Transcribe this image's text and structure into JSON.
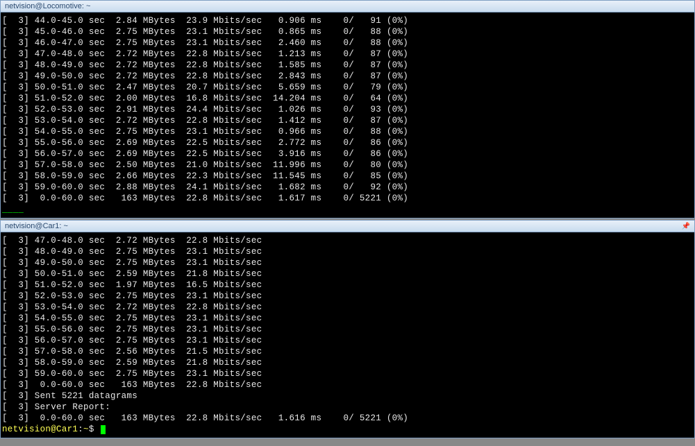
{
  "pane1": {
    "title": "netvision@Locomotive: ~",
    "pin": "",
    "rows": [
      {
        "id": "3",
        "interval": "44.0-45.0",
        "unit": "sec",
        "transfer": "2.84",
        "tunit": "MBytes",
        "bw": "23.9",
        "bwunit": "Mbits/sec",
        "jitter": "0.906",
        "junit": "ms",
        "lost": "0",
        "total": "91",
        "pct": "(0%)"
      },
      {
        "id": "3",
        "interval": "45.0-46.0",
        "unit": "sec",
        "transfer": "2.75",
        "tunit": "MBytes",
        "bw": "23.1",
        "bwunit": "Mbits/sec",
        "jitter": "0.865",
        "junit": "ms",
        "lost": "0",
        "total": "88",
        "pct": "(0%)"
      },
      {
        "id": "3",
        "interval": "46.0-47.0",
        "unit": "sec",
        "transfer": "2.75",
        "tunit": "MBytes",
        "bw": "23.1",
        "bwunit": "Mbits/sec",
        "jitter": "2.460",
        "junit": "ms",
        "lost": "0",
        "total": "88",
        "pct": "(0%)"
      },
      {
        "id": "3",
        "interval": "47.0-48.0",
        "unit": "sec",
        "transfer": "2.72",
        "tunit": "MBytes",
        "bw": "22.8",
        "bwunit": "Mbits/sec",
        "jitter": "1.213",
        "junit": "ms",
        "lost": "0",
        "total": "87",
        "pct": "(0%)"
      },
      {
        "id": "3",
        "interval": "48.0-49.0",
        "unit": "sec",
        "transfer": "2.72",
        "tunit": "MBytes",
        "bw": "22.8",
        "bwunit": "Mbits/sec",
        "jitter": "1.585",
        "junit": "ms",
        "lost": "0",
        "total": "87",
        "pct": "(0%)"
      },
      {
        "id": "3",
        "interval": "49.0-50.0",
        "unit": "sec",
        "transfer": "2.72",
        "tunit": "MBytes",
        "bw": "22.8",
        "bwunit": "Mbits/sec",
        "jitter": "2.843",
        "junit": "ms",
        "lost": "0",
        "total": "87",
        "pct": "(0%)"
      },
      {
        "id": "3",
        "interval": "50.0-51.0",
        "unit": "sec",
        "transfer": "2.47",
        "tunit": "MBytes",
        "bw": "20.7",
        "bwunit": "Mbits/sec",
        "jitter": "5.659",
        "junit": "ms",
        "lost": "0",
        "total": "79",
        "pct": "(0%)"
      },
      {
        "id": "3",
        "interval": "51.0-52.0",
        "unit": "sec",
        "transfer": "2.00",
        "tunit": "MBytes",
        "bw": "16.8",
        "bwunit": "Mbits/sec",
        "jitter": "14.204",
        "junit": "ms",
        "lost": "0",
        "total": "64",
        "pct": "(0%)"
      },
      {
        "id": "3",
        "interval": "52.0-53.0",
        "unit": "sec",
        "transfer": "2.91",
        "tunit": "MBytes",
        "bw": "24.4",
        "bwunit": "Mbits/sec",
        "jitter": "1.026",
        "junit": "ms",
        "lost": "0",
        "total": "93",
        "pct": "(0%)"
      },
      {
        "id": "3",
        "interval": "53.0-54.0",
        "unit": "sec",
        "transfer": "2.72",
        "tunit": "MBytes",
        "bw": "22.8",
        "bwunit": "Mbits/sec",
        "jitter": "1.412",
        "junit": "ms",
        "lost": "0",
        "total": "87",
        "pct": "(0%)"
      },
      {
        "id": "3",
        "interval": "54.0-55.0",
        "unit": "sec",
        "transfer": "2.75",
        "tunit": "MBytes",
        "bw": "23.1",
        "bwunit": "Mbits/sec",
        "jitter": "0.966",
        "junit": "ms",
        "lost": "0",
        "total": "88",
        "pct": "(0%)"
      },
      {
        "id": "3",
        "interval": "55.0-56.0",
        "unit": "sec",
        "transfer": "2.69",
        "tunit": "MBytes",
        "bw": "22.5",
        "bwunit": "Mbits/sec",
        "jitter": "2.772",
        "junit": "ms",
        "lost": "0",
        "total": "86",
        "pct": "(0%)"
      },
      {
        "id": "3",
        "interval": "56.0-57.0",
        "unit": "sec",
        "transfer": "2.69",
        "tunit": "MBytes",
        "bw": "22.5",
        "bwunit": "Mbits/sec",
        "jitter": "3.916",
        "junit": "ms",
        "lost": "0",
        "total": "86",
        "pct": "(0%)"
      },
      {
        "id": "3",
        "interval": "57.0-58.0",
        "unit": "sec",
        "transfer": "2.50",
        "tunit": "MBytes",
        "bw": "21.0",
        "bwunit": "Mbits/sec",
        "jitter": "11.996",
        "junit": "ms",
        "lost": "0",
        "total": "80",
        "pct": "(0%)"
      },
      {
        "id": "3",
        "interval": "58.0-59.0",
        "unit": "sec",
        "transfer": "2.66",
        "tunit": "MBytes",
        "bw": "22.3",
        "bwunit": "Mbits/sec",
        "jitter": "11.545",
        "junit": "ms",
        "lost": "0",
        "total": "85",
        "pct": "(0%)"
      },
      {
        "id": "3",
        "interval": "59.0-60.0",
        "unit": "sec",
        "transfer": "2.88",
        "tunit": "MBytes",
        "bw": "24.1",
        "bwunit": "Mbits/sec",
        "jitter": "1.682",
        "junit": "ms",
        "lost": "0",
        "total": "92",
        "pct": "(0%)"
      },
      {
        "id": "3",
        "interval": " 0.0-60.0",
        "unit": "sec",
        "transfer": " 163",
        "tunit": "MBytes",
        "bw": "22.8",
        "bwunit": "Mbits/sec",
        "jitter": "1.617",
        "junit": "ms",
        "lost": "0",
        "total": "5221",
        "pct": "(0%)"
      }
    ]
  },
  "pane2": {
    "title": "netvision@Car1: ~",
    "pin": "📌",
    "rows": [
      {
        "id": "3",
        "interval": "47.0-48.0",
        "unit": "sec",
        "transfer": "2.72",
        "tunit": "MBytes",
        "bw": "22.8",
        "bwunit": "Mbits/sec"
      },
      {
        "id": "3",
        "interval": "48.0-49.0",
        "unit": "sec",
        "transfer": "2.75",
        "tunit": "MBytes",
        "bw": "23.1",
        "bwunit": "Mbits/sec"
      },
      {
        "id": "3",
        "interval": "49.0-50.0",
        "unit": "sec",
        "transfer": "2.75",
        "tunit": "MBytes",
        "bw": "23.1",
        "bwunit": "Mbits/sec"
      },
      {
        "id": "3",
        "interval": "50.0-51.0",
        "unit": "sec",
        "transfer": "2.59",
        "tunit": "MBytes",
        "bw": "21.8",
        "bwunit": "Mbits/sec"
      },
      {
        "id": "3",
        "interval": "51.0-52.0",
        "unit": "sec",
        "transfer": "1.97",
        "tunit": "MBytes",
        "bw": "16.5",
        "bwunit": "Mbits/sec"
      },
      {
        "id": "3",
        "interval": "52.0-53.0",
        "unit": "sec",
        "transfer": "2.75",
        "tunit": "MBytes",
        "bw": "23.1",
        "bwunit": "Mbits/sec"
      },
      {
        "id": "3",
        "interval": "53.0-54.0",
        "unit": "sec",
        "transfer": "2.72",
        "tunit": "MBytes",
        "bw": "22.8",
        "bwunit": "Mbits/sec"
      },
      {
        "id": "3",
        "interval": "54.0-55.0",
        "unit": "sec",
        "transfer": "2.75",
        "tunit": "MBytes",
        "bw": "23.1",
        "bwunit": "Mbits/sec"
      },
      {
        "id": "3",
        "interval": "55.0-56.0",
        "unit": "sec",
        "transfer": "2.75",
        "tunit": "MBytes",
        "bw": "23.1",
        "bwunit": "Mbits/sec"
      },
      {
        "id": "3",
        "interval": "56.0-57.0",
        "unit": "sec",
        "transfer": "2.75",
        "tunit": "MBytes",
        "bw": "23.1",
        "bwunit": "Mbits/sec"
      },
      {
        "id": "3",
        "interval": "57.0-58.0",
        "unit": "sec",
        "transfer": "2.56",
        "tunit": "MBytes",
        "bw": "21.5",
        "bwunit": "Mbits/sec"
      },
      {
        "id": "3",
        "interval": "58.0-59.0",
        "unit": "sec",
        "transfer": "2.59",
        "tunit": "MBytes",
        "bw": "21.8",
        "bwunit": "Mbits/sec"
      },
      {
        "id": "3",
        "interval": "59.0-60.0",
        "unit": "sec",
        "transfer": "2.75",
        "tunit": "MBytes",
        "bw": "23.1",
        "bwunit": "Mbits/sec"
      },
      {
        "id": "3",
        "interval": " 0.0-60.0",
        "unit": "sec",
        "transfer": " 163",
        "tunit": "MBytes",
        "bw": "22.8",
        "bwunit": "Mbits/sec"
      }
    ],
    "sent_line": {
      "id": "3",
      "text": "Sent 5221 datagrams"
    },
    "server_line": {
      "id": "3",
      "text": "Server Report:"
    },
    "summary": {
      "id": "3",
      "interval": " 0.0-60.0",
      "unit": "sec",
      "transfer": " 163",
      "tunit": "MBytes",
      "bw": "22.8",
      "bwunit": "Mbits/sec",
      "jitter": "1.616",
      "junit": "ms",
      "lost": "0",
      "total": "5221",
      "pct": "(0%)"
    },
    "prompt_user": "netvision@Car1",
    "prompt_sep": ":",
    "prompt_path": "~",
    "prompt_suffix": "$"
  }
}
